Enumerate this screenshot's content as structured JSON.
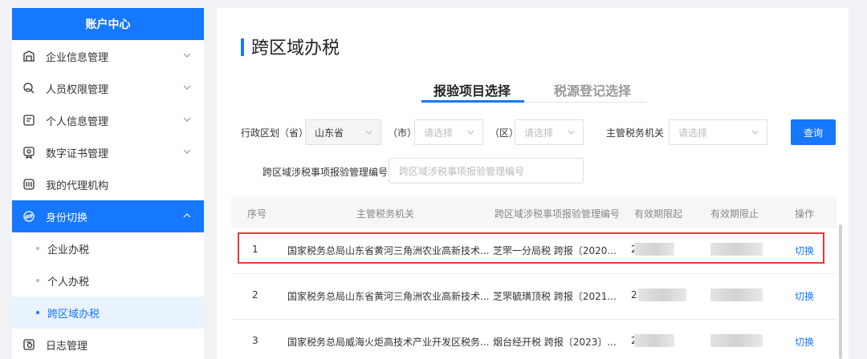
{
  "sidebar": {
    "header": "账户中心",
    "items": [
      {
        "label": "企业信息管理",
        "icon": "building-icon"
      },
      {
        "label": "人员权限管理",
        "icon": "user-search-icon"
      },
      {
        "label": "个人信息管理",
        "icon": "id-card-icon"
      },
      {
        "label": "数字证书管理",
        "icon": "certificate-icon"
      },
      {
        "label": "我的代理机构",
        "icon": "agency-icon"
      },
      {
        "label": "身份切换",
        "icon": "switch-icon"
      }
    ],
    "sub_items": [
      "企业办税",
      "个人办税",
      "跨区域办税"
    ],
    "footer_item": {
      "label": "日志管理",
      "icon": "log-icon"
    }
  },
  "main": {
    "title": "跨区域办税",
    "tabs": [
      "报验项目选择",
      "税源登记选择"
    ],
    "filters": {
      "province_label": "行政区划（省）",
      "province_value": "山东省",
      "city_label": "（市）",
      "city_placeholder": "请选择",
      "district_label": "（区）",
      "district_placeholder": "请选择",
      "authority_label": "主管税务机关",
      "authority_placeholder": "请选择",
      "query_button": "查询",
      "code_label": "跨区域涉税事项报验管理编号",
      "code_placeholder": "跨区域涉税事项报验管理编号"
    },
    "table": {
      "headers": [
        "序号",
        "主管税务机关",
        "跨区域涉税事项报验管理编号",
        "有效期限起",
        "有效期限止",
        "操作"
      ],
      "rows": [
        {
          "no": "1",
          "authority": "国家税务总局山东省黄河三角洲农业高新技术...",
          "code": "芝罘一分局税 跨报〔2020...",
          "start": "2",
          "action": "切换"
        },
        {
          "no": "2",
          "authority": "国家税务总局山东省黄河三角洲农业高新技术...",
          "code": "芝罘毓璜顶税 跨报〔2021...",
          "start": "2",
          "action": "切换"
        },
        {
          "no": "3",
          "authority": "国家税务总局威海火炬高技术产业开发区税务...",
          "code": "烟台经开税 跨报〔2023〕...",
          "start": "2",
          "action": "切换"
        }
      ]
    }
  }
}
